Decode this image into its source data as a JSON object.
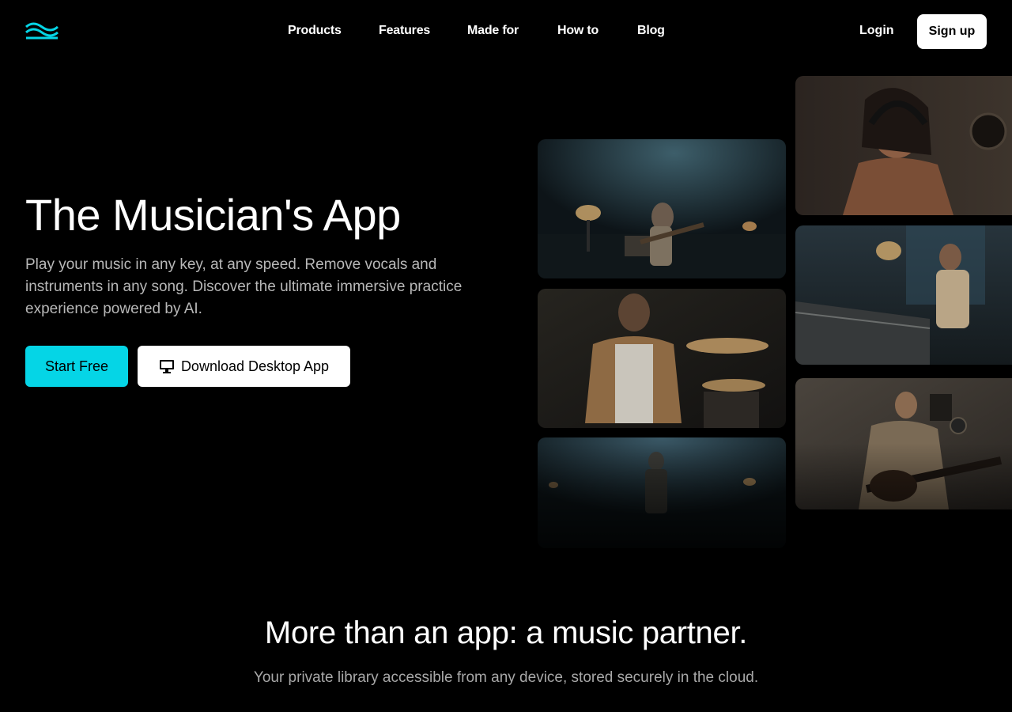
{
  "nav": {
    "logo_icon": "wave-logo-icon",
    "links": [
      {
        "label": "Products"
      },
      {
        "label": "Features"
      },
      {
        "label": "Made for"
      },
      {
        "label": "How to"
      },
      {
        "label": "Blog"
      }
    ],
    "login_label": "Login",
    "signup_label": "Sign up"
  },
  "hero": {
    "title": "The Musician's App",
    "subtitle": "Play your music in any key, at any speed. Remove vocals and instruments in any song. Discover the ultimate immersive practice experience powered by AI.",
    "start_label": "Start Free",
    "download_label": "Download Desktop App",
    "download_icon": "monitor-icon"
  },
  "section": {
    "title": "More than an app: a music partner.",
    "subtitle": "Your private library accessible from any device, stored securely in the cloud."
  },
  "colors": {
    "accent": "#05d5e6",
    "background": "#000000"
  }
}
